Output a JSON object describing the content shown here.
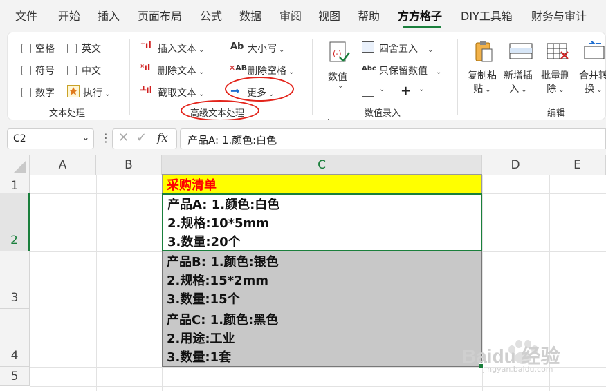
{
  "tabs": [
    "文件",
    "开始",
    "插入",
    "页面布局",
    "公式",
    "数据",
    "审阅",
    "视图",
    "帮助",
    "方方格子",
    "DIY工具箱",
    "财务与审计"
  ],
  "active_tab": "方方格子",
  "ribbon": {
    "text_group": {
      "label": "文本处理",
      "checkboxes": [
        "空格",
        "英文",
        "符号",
        "中文",
        "数字"
      ],
      "execute": "执行"
    },
    "adv_group": {
      "label": "高级文本处理",
      "insert_text": "插入文本",
      "delete_text": "删除文本",
      "extract_text": "截取文本",
      "case": "大小写",
      "delete_space": "删除空格",
      "more": "更多"
    },
    "num_group": {
      "label": "数值录入",
      "value": "数值",
      "round": "四舍五入",
      "keep_value": "只保留数值"
    },
    "edit_group": {
      "label": "编辑",
      "copy_paste": [
        "复制粘",
        "贴"
      ],
      "insert_new": [
        "新增插",
        "入"
      ],
      "batch_delete": [
        "批量删",
        "除"
      ],
      "merge_convert": [
        "合并转",
        "换"
      ]
    }
  },
  "formula_bar": {
    "name_box": "C2",
    "fx": "fx",
    "content": "产品A: 1.颜色:白色"
  },
  "columns": [
    "A",
    "B",
    "C",
    "D",
    "E"
  ],
  "rows": [
    "1",
    "2",
    "3",
    "4",
    "5"
  ],
  "cells": {
    "c1": "采购清单",
    "c2": [
      "产品A: 1.颜色:白色",
      "2.规格:10*5mm",
      "3.数量:20个"
    ],
    "c3": [
      "产品B: 1.颜色:银色",
      "2.规格:15*2mm",
      "3.数量:15个"
    ],
    "c4": [
      "产品C: 1.颜色:黑色",
      "2.用途:工业",
      "3.数量:1套"
    ]
  },
  "watermark": {
    "brand": "Baidu 经验",
    "url": "jingyan.baidu.com"
  },
  "colors": {
    "accent": "#1a7f3c",
    "highlight": "#ffff00",
    "title_text": "#ff0000",
    "annotation": "#e3241b",
    "row_fill": "#c8c8c8"
  }
}
